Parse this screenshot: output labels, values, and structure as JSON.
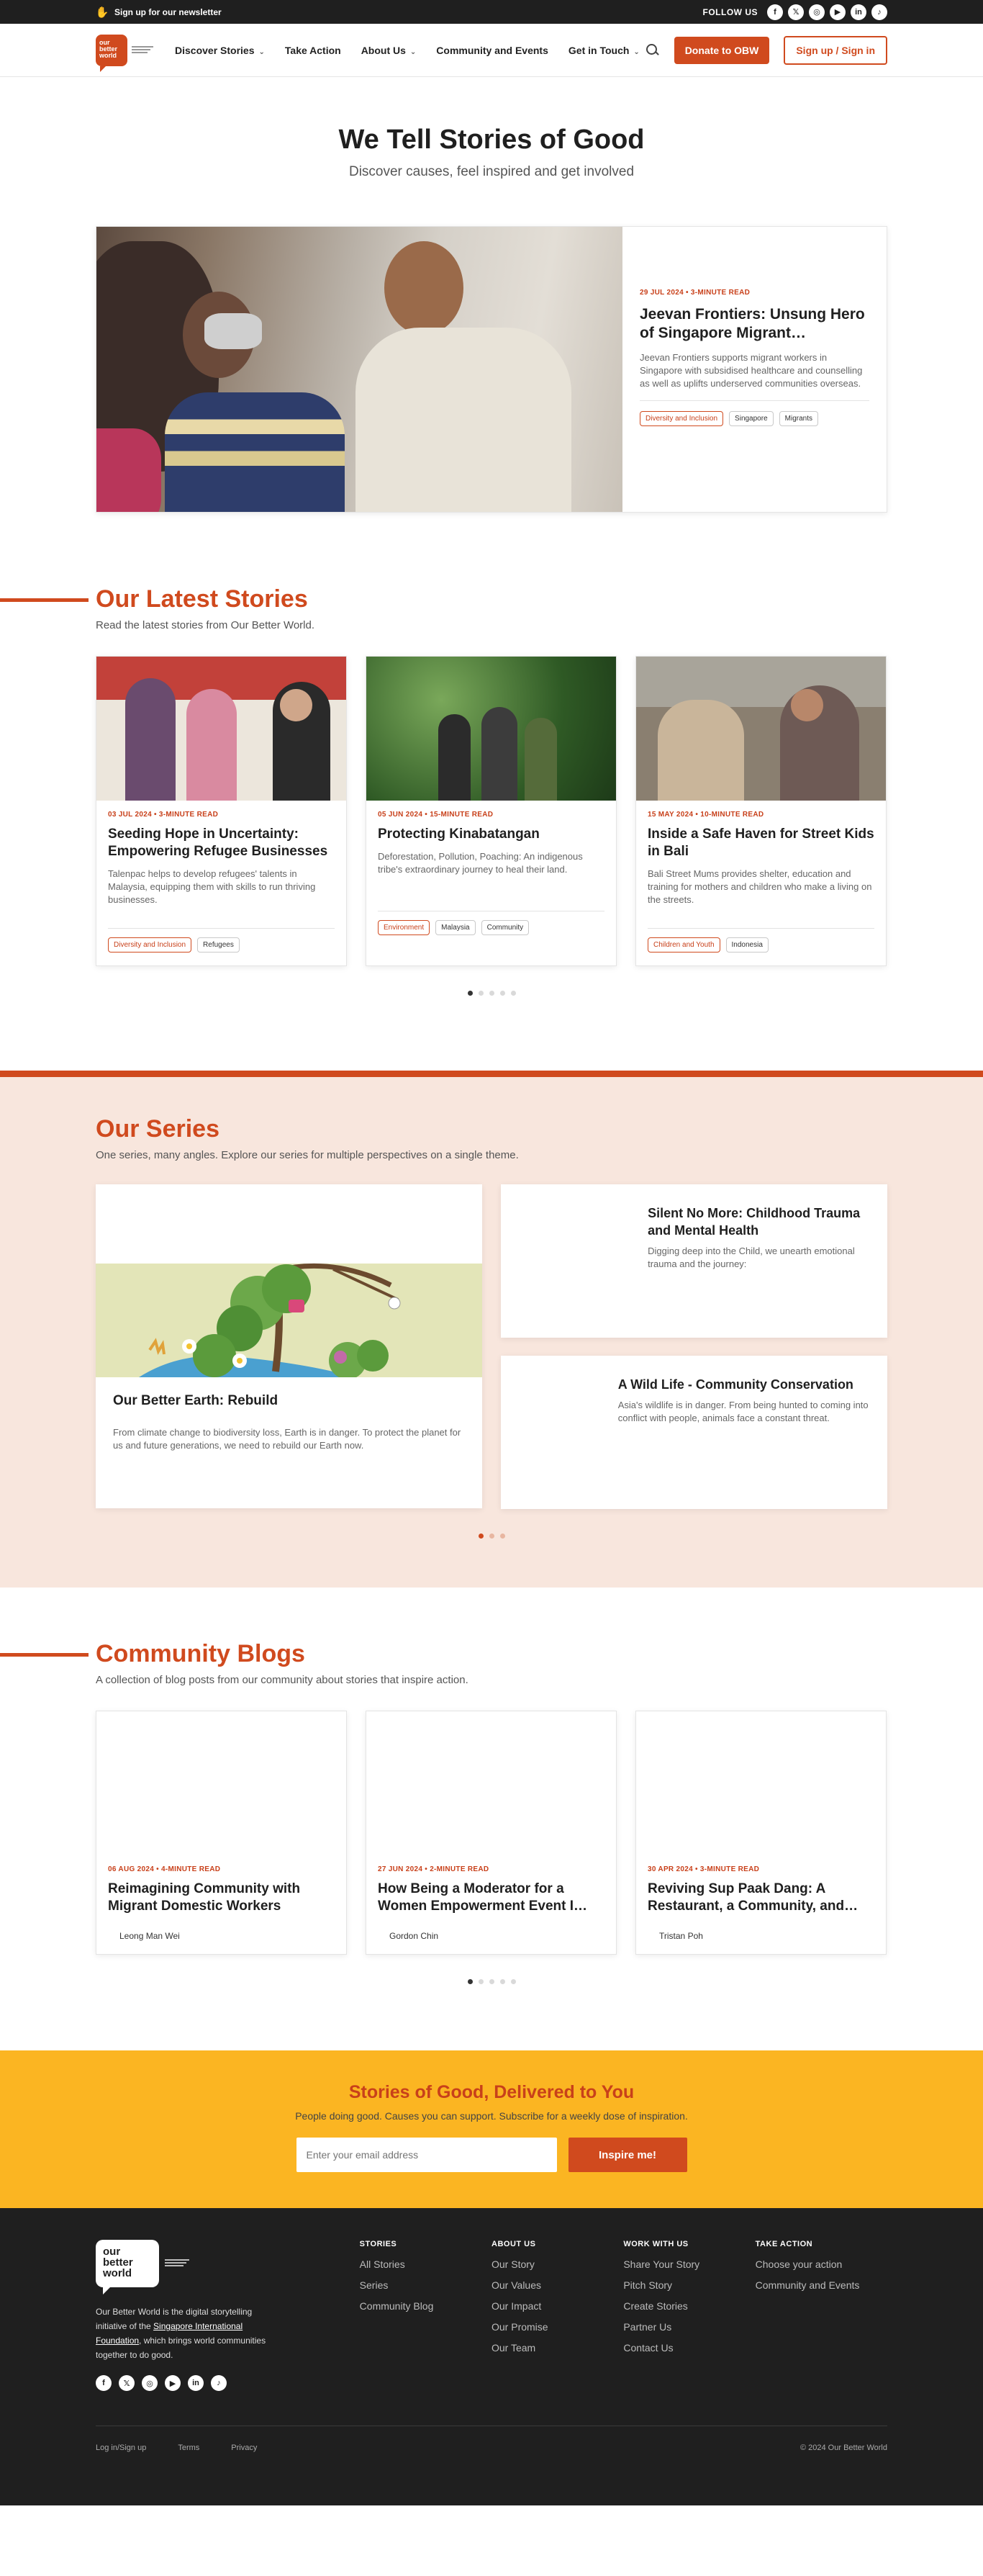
{
  "topbar": {
    "newsletter_label": "Sign up for our newsletter",
    "follow_label": "FOLLOW US",
    "social_icons": [
      "facebook-icon",
      "x-icon",
      "instagram-icon",
      "youtube-icon",
      "linkedin-icon",
      "tiktok-icon"
    ]
  },
  "nav": {
    "logo_text": "our better world",
    "items": [
      {
        "label": "Discover Stories",
        "dropdown": true
      },
      {
        "label": "Take Action",
        "dropdown": false
      },
      {
        "label": "About Us",
        "dropdown": true
      },
      {
        "label": "Community and Events",
        "dropdown": false
      },
      {
        "label": "Get in Touch",
        "dropdown": true
      }
    ],
    "donate_label": "Donate to OBW",
    "signin_label": "Sign up / Sign in"
  },
  "hero": {
    "title": "We Tell Stories of Good",
    "subtitle": "Discover causes, feel inspired and get involved"
  },
  "featured": {
    "meta": "29 JUL 2024 • 3-MINUTE READ",
    "title": "Jeevan Frontiers: Unsung Hero of Singapore Migrant…",
    "excerpt": "Jeevan Frontiers supports migrant workers in Singapore with subsidised healthcare and counselling as well as uplifts underserved communities overseas.",
    "tags": [
      "Diversity and Inclusion",
      "Singapore",
      "Migrants"
    ]
  },
  "latest": {
    "title": "Our Latest Stories",
    "subtitle": "Read the latest stories from Our Better World.",
    "cards": [
      {
        "meta": "03 JUL 2024 • 3-MINUTE READ",
        "title": "Seeding Hope in Uncertainty: Empowering Refugee Businesses",
        "excerpt": "Talenpac helps to develop refugees' talents in Malaysia, equipping them with skills to run thriving businesses.",
        "tags": [
          "Diversity and Inclusion",
          "Refugees"
        ]
      },
      {
        "meta": "05 JUN 2024 • 15-MINUTE READ",
        "title": "Protecting Kinabatangan",
        "excerpt": "Deforestation, Pollution, Poaching: An indigenous tribe's extraordinary journey to heal their land.",
        "tags": [
          "Environment",
          "Malaysia",
          "Community"
        ]
      },
      {
        "meta": "15 MAY 2024 • 10-MINUTE READ",
        "title": "Inside a Safe Haven for Street Kids in Bali",
        "excerpt": "Bali Street Mums provides shelter, education and training for mothers and children who make a living on the streets.",
        "tags": [
          "Children and Youth",
          "Indonesia"
        ]
      }
    ]
  },
  "series": {
    "title": "Our Series",
    "subtitle": "One series, many angles. Explore our series for multiple perspectives on a single theme.",
    "main": {
      "title": "Our Better Earth: Rebuild",
      "excerpt": "From climate change to biodiversity loss, Earth is in danger. To protect the planet for us and future generations, we need to rebuild our Earth now."
    },
    "side": [
      {
        "title": "Silent No More: Childhood Trauma and Mental Health",
        "excerpt": "Digging deep into the Child, we unearth emotional trauma and the journey:"
      },
      {
        "title": "A Wild Life - Community Conservation",
        "excerpt": "Asia's wildlife is in danger. From being hunted to coming into conflict with people, animals face a constant threat."
      }
    ]
  },
  "blogs": {
    "title": "Community Blogs",
    "subtitle": "A collection of blog posts from our community about stories that inspire action.",
    "cards": [
      {
        "meta": "06 AUG 2024 • 4-MINUTE READ",
        "title": "Reimagining Community with Migrant Domestic Workers",
        "author": "Leong Man Wei"
      },
      {
        "meta": "27 JUN 2024 • 2-MINUTE READ",
        "title": "How Being a Moderator for a Women Empowerment Event I…",
        "author": "Gordon Chin"
      },
      {
        "meta": "30 APR 2024 • 3-MINUTE READ",
        "title": "Reviving Sup Paak Dang: A Restaurant, a Community, and…",
        "author": "Tristan Poh"
      }
    ]
  },
  "newsletter": {
    "title": "Stories of Good, Delivered to You",
    "subtitle": "People doing good. Causes you can support. Subscribe for a weekly dose of inspiration.",
    "placeholder": "Enter your email address",
    "button": "Inspire me!"
  },
  "footer": {
    "logo_text": "our better world",
    "about_prefix": "Our Better World is the digital storytelling initiative of the ",
    "about_link": "Singapore International Foundation",
    "about_suffix": ", which brings world communities together to do good.",
    "columns": [
      {
        "heading": "STORIES",
        "links": [
          "All Stories",
          "Series",
          "Community Blog"
        ]
      },
      {
        "heading": "ABOUT US",
        "links": [
          "Our Story",
          "Our Values",
          "Our Impact",
          "Our Promise",
          "Our Team"
        ]
      },
      {
        "heading": "WORK WITH US",
        "links": [
          "Share Your Story",
          "Pitch Story",
          "Create Stories",
          "Partner Us",
          "Contact Us"
        ]
      },
      {
        "heading": "TAKE ACTION",
        "links": [
          "Choose your action",
          "Community and Events"
        ]
      }
    ],
    "bottom_links": [
      "Log in/Sign up",
      "Terms",
      "Privacy"
    ],
    "copyright": "© 2024 Our Better World"
  },
  "colors": {
    "accent": "#d04a1e",
    "yellow": "#fbb522",
    "dark": "#1f1f1f",
    "series_bg": "#f8e6dd"
  }
}
